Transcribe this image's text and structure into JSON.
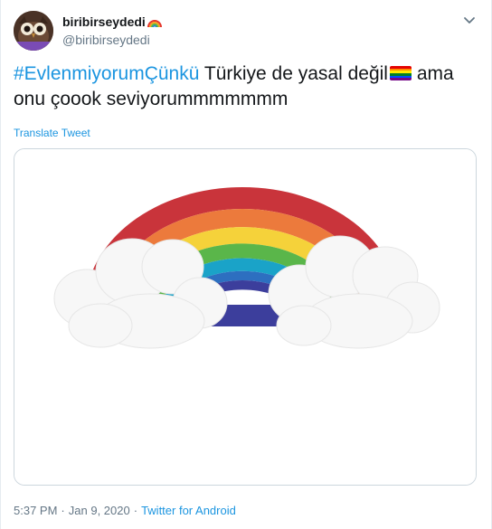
{
  "user": {
    "display_name": "biribirseydedi",
    "handle": "@biribirseydedi"
  },
  "tweet": {
    "hashtag": "#EvlenmiyorumÇünkü",
    "text_part1": " Türkiye de yasal değil",
    "text_part2": " ama",
    "text_line2": "onu çoook seviyorummmmmmm",
    "translate_label": "Translate Tweet"
  },
  "meta": {
    "time": "5:37 PM",
    "separator1": "·",
    "date": "Jan 9, 2020",
    "separator2": "·",
    "source": "Twitter for Android"
  },
  "icons": {
    "avatar": "owl-avatar",
    "name_emoji": "rainbow-emoji",
    "text_emoji": "rainbow-flag-emoji",
    "caret": "chevron-down-icon"
  },
  "colors": {
    "link": "#1b95e0",
    "text": "#14171a",
    "muted": "#657786",
    "border": "#ccd6dd"
  }
}
